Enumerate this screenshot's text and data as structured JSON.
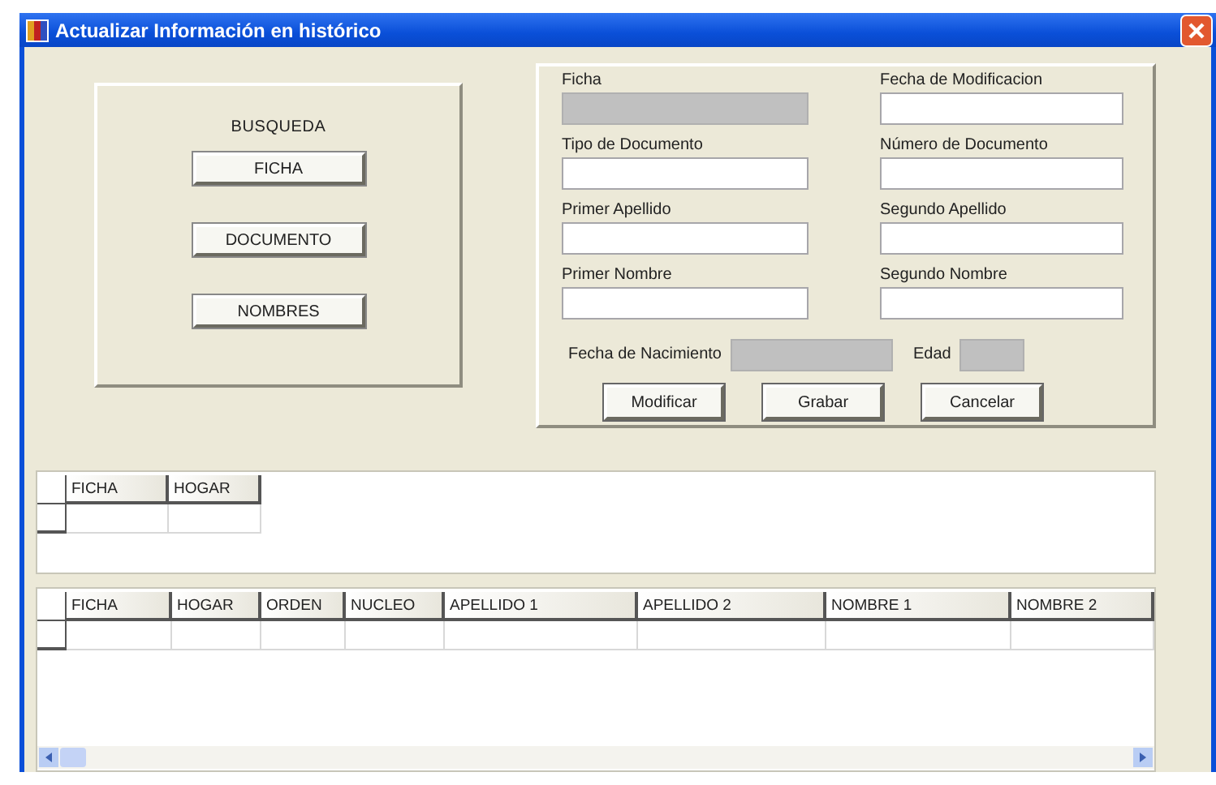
{
  "window": {
    "title": "Actualizar Información en histórico"
  },
  "search": {
    "title": "BUSQUEDA",
    "buttons": [
      "FICHA",
      "DOCUMENTO",
      "NOMBRES"
    ]
  },
  "form": {
    "fields": [
      {
        "label": "Ficha",
        "disabled": true
      },
      {
        "label": "Fecha de Modificacion",
        "disabled": false
      },
      {
        "label": "Tipo de Documento",
        "disabled": false
      },
      {
        "label": "Número de Documento",
        "disabled": false
      },
      {
        "label": "Primer Apellido",
        "disabled": false
      },
      {
        "label": "Segundo Apellido",
        "disabled": false
      },
      {
        "label": "Primer Nombre",
        "disabled": false
      },
      {
        "label": "Segundo Nombre",
        "disabled": false
      }
    ],
    "birth": {
      "label": "Fecha de Nacimiento",
      "disabled": true
    },
    "age": {
      "label": "Edad",
      "disabled": true
    },
    "buttons": [
      "Modificar",
      "Grabar",
      "Cancelar"
    ]
  },
  "grid_1": {
    "columns": [
      "FICHA",
      "HOGAR"
    ]
  },
  "grid_2": {
    "columns": [
      "FICHA",
      "HOGAR",
      "ORDEN",
      "NUCLEO",
      "APELLIDO 1",
      "APELLIDO 2",
      "NOMBRE 1",
      "NOMBRE 2"
    ]
  }
}
